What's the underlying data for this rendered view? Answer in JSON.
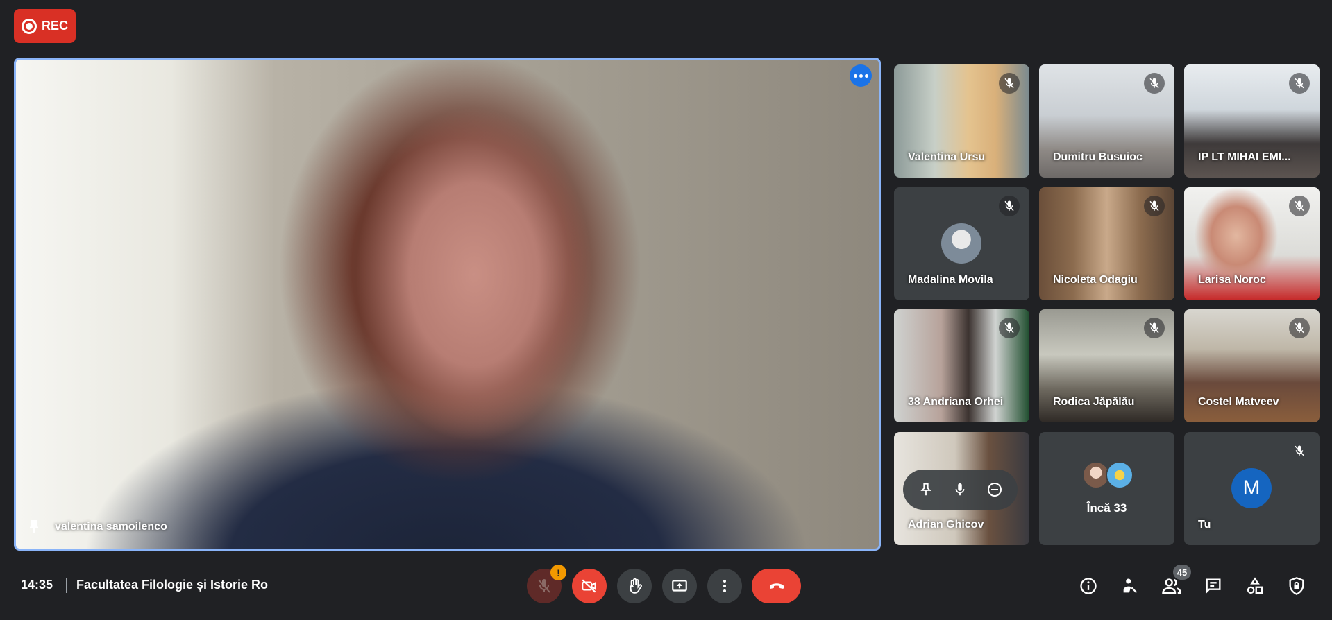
{
  "recording": {
    "label": "REC"
  },
  "main_speaker": {
    "name": "valentina samoilenco"
  },
  "participants": [
    {
      "name": "Valentina Ursu"
    },
    {
      "name": "Dumitru Busuioc"
    },
    {
      "name": "IP LT MIHAI EMI..."
    },
    {
      "name": "Madalina Movila"
    },
    {
      "name": "Nicoleta Odagiu"
    },
    {
      "name": "Larisa Noroc"
    },
    {
      "name": "38 Andriana Orhei"
    },
    {
      "name": "Rodica Jăpălău"
    },
    {
      "name": "Costel Matveev"
    },
    {
      "name": "Adrian Ghicov"
    }
  ],
  "more_tile": {
    "label": "Încă 33"
  },
  "self_tile": {
    "initial": "M",
    "name": "Tu"
  },
  "footer": {
    "time": "14:35",
    "meeting_title": "Facultatea Filologie și Istorie Ro",
    "mic_warning": "!",
    "people_count": "45"
  },
  "colors": {
    "accent_blue": "#1a73e8",
    "danger_red": "#ea4335",
    "background": "#202124",
    "tile": "#3c4043",
    "warning": "#f29900"
  }
}
